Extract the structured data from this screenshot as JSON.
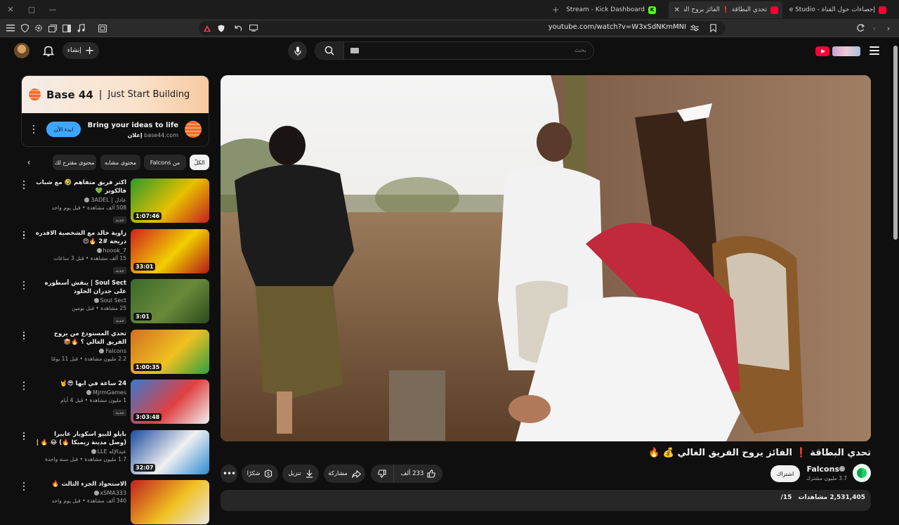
{
  "browser": {
    "tabs": [
      {
        "label": "إحصاءات حول القناة - YouTube Studio",
        "color": "#ff0033"
      },
      {
        "label": "تحدي البطاقة ❗ الفائز يروح الف...",
        "color": "#ff0033",
        "active": true
      },
      {
        "label": "Stream - Kick Dashboard",
        "color": "#53fc18"
      }
    ],
    "new_tab_label": "+",
    "url": "youtube.com/watch?v=W3xSdNKmMNI"
  },
  "masthead": {
    "create_label": "إنشاء",
    "search_placeholder": "بحث"
  },
  "ad": {
    "brand": "Base 44",
    "separator": "|",
    "tagline": "Just Start Building",
    "title": "Bring your ideas to life",
    "label": "إعلان",
    "domain": "base44.com",
    "cta": "ابدء الآن"
  },
  "chips": {
    "all": "الكلّ",
    "from_channel": "من Falcons",
    "similar": "محتوى مشابه",
    "suggested": "محتوى مقترح لك"
  },
  "related": [
    {
      "title": "اكثر فريق متفاهم 🤣 مع شباب فالكونز 💚",
      "channel": "عادل | 3ADEL",
      "views": "508 ألف مشاهدة • قبل يوم واحد",
      "badge": "جديد",
      "duration": "1:07:46",
      "colors": [
        "#2f9a2a",
        "#e8c000",
        "#c02020"
      ]
    },
    {
      "title": "زاوية خالد مع الشخصية الاقدره دريحة #2 🔥😍",
      "channel": "hoook_7",
      "views": "15 ألف مشاهدة • قبل 3 ساعات",
      "badge": "جديد",
      "duration": "33:01",
      "colors": [
        "#d02020",
        "#f0d000",
        "#b01818"
      ]
    },
    {
      "title": "Soul Sect | ينقش أسطوره على جدران الخلود",
      "channel": "Soul Sect",
      "views": "25 مشاهدة • قبل يومين",
      "badge": "جديد",
      "duration": "3:01",
      "colors": [
        "#3a6a2a",
        "#6a8a3a",
        "#2a4a1a"
      ]
    },
    {
      "title": "تحدي المستودع من يروح الفريق الغالي ؟ 🔥📦",
      "channel": "Falcons",
      "views": "2.2 مليون مشاهدة • قبل 11 يومًا",
      "badge": "",
      "duration": "1:00:35",
      "colors": [
        "#d07020",
        "#f0c020",
        "#30a040"
      ]
    },
    {
      "title": "24 ساعة في ابها 😎🤘",
      "channel": "MjrmGames",
      "views": "1 مليون مشاهدة • قبل 4 أيام",
      "badge": "جديد",
      "duration": "3:03:48",
      "colors": [
        "#3a7ad0",
        "#e04040",
        "#f0f0f0"
      ]
    },
    {
      "title": "بايلو للبيو اسكوبار عابيرا (وصل مدينة زيمبكا 🔥) 😂 🔥 | فرائد الحياة الواقع...",
      "channel": "عبدالإله LLE",
      "views": "1.7 مليون مشاهدة • قبل سنة واحدة",
      "badge": "",
      "duration": "32:07",
      "colors": [
        "#1a4aa0",
        "#f0f0f0",
        "#2a8ad0"
      ]
    },
    {
      "title": "الاستحواذ الجزء الثالث 🔥",
      "channel": "xSMA333",
      "views": "340 ألف مشاهدة • قبل يوم واحد",
      "badge": "",
      "duration": "",
      "colors": [
        "#c02020",
        "#f0c020",
        "#e8e8e8"
      ]
    }
  ],
  "video": {
    "title": "تحدي البطاقة ❗ الفائز يروح الفريق الغالي 💰 🔥",
    "channel": "Falcons",
    "subscribers": "3.7 مليون مشترك",
    "subscribe_label": "اشتراك",
    "likes": "233 ألف",
    "share_label": "مشاركة",
    "download_label": "تنزيل",
    "thanks_label": "شكرًا",
    "views": "2,531,405 مشاهدات",
    "date": "15/"
  },
  "colors": {
    "accent_blue": "#3ea6ff",
    "yt_red": "#ff0033",
    "kick_green": "#53fc18"
  }
}
